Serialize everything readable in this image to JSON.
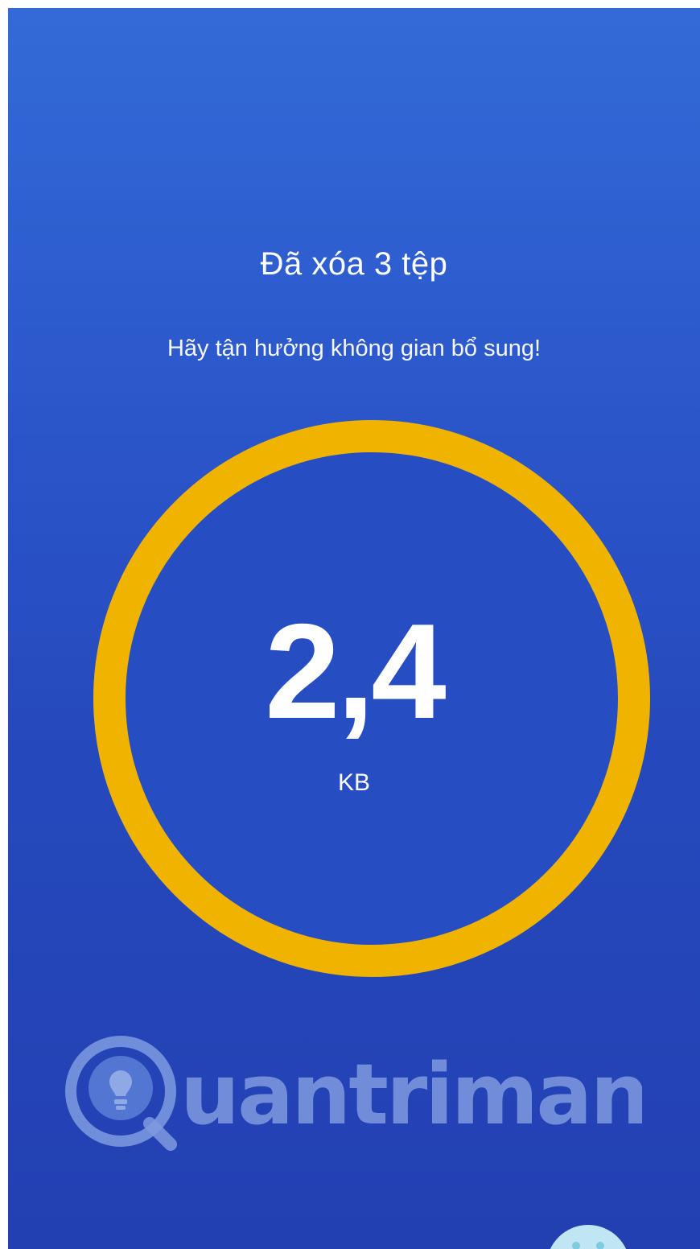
{
  "result": {
    "title": "Đã xóa 3 tệp",
    "subtitle": "Hãy tận hưởng không gian bổ sung!",
    "freed_value": "2,4",
    "freed_unit": "KB"
  },
  "watermark": {
    "text": "uantrimang"
  },
  "colors": {
    "background_top": "#336ad8",
    "background_bottom": "#2340b2",
    "ring": "#f0b400",
    "text": "#ffffff"
  },
  "icons": {
    "watermark_logo": "lightbulb-q-icon",
    "mascot": "mascot-icon"
  }
}
